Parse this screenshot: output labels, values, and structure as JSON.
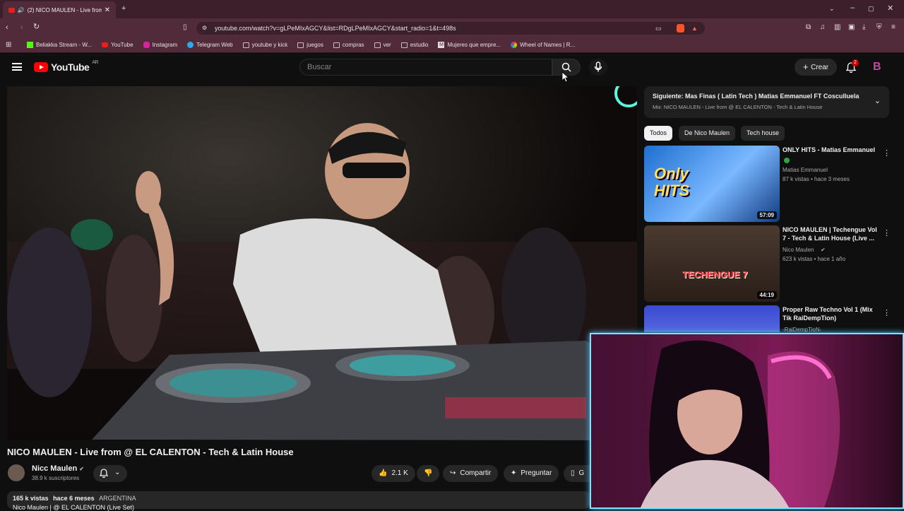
{
  "browser": {
    "tab_title": "(2) NICO MAULEN - Live from",
    "url": "youtube.com/watch?v=gLPeMIxAGCY&list=RDgLPeMIxAGCY&start_radio=1&t=498s",
    "bookmarks": [
      "Beliakka Stream - W...",
      "YouTube",
      "Instagram",
      "Telegram Web",
      "youtube y kick",
      "juegos",
      "compras",
      "ver",
      "estudio",
      "Mujeres que empre...",
      "Wheel of Names | R..."
    ]
  },
  "header": {
    "logo_text": "YouTube",
    "country": "AR",
    "search_placeholder": "Buscar",
    "create_label": "Crear",
    "notif_count": "2"
  },
  "video": {
    "title": "NICO MAULEN - Live from @ EL CALENTON - Tech & Latin House",
    "channel": "Nicc Maulen",
    "subscribers": "38.9 k suscriptores",
    "likes": "2.1 K",
    "share_label": "Compartir",
    "ask_label": "Preguntar",
    "save_label": "G",
    "views": "165 k vistas",
    "date": "hace 6 meses",
    "location": "ARGENTINA",
    "desc_line": "Nico Maulen | @ EL CALENTON (Live Set)"
  },
  "panel": {
    "next_label": "Siguiente:",
    "next_title": "Mas Finas ( Latin Tech ) Matias Emmanuel FT Cosculluela",
    "mix_label": "Mix: NICO MAULEN - Live from @ EL CALENTON - Tech & Latin House",
    "chips": [
      "Todos",
      "De Nico Maulen",
      "Tech house"
    ],
    "recs": [
      {
        "title": "ONLY HITS - Matias Emmanuel",
        "channel": "Matias Emmanuel",
        "meta": "87 k vistas • hace 3 meses",
        "duration": "57:09",
        "thumb_text": "Only HITS"
      },
      {
        "title": "NICO MAULEN | Techengue Vol 7 - Tech & Latin House (Live ...",
        "channel": "Nico Maulen",
        "meta": "623 k vistas • hace 1 año",
        "duration": "44:19",
        "thumb_text": "TECHENGUE 7"
      },
      {
        "title": "Proper Raw Techno Vol 1 (Mix Tik RaiDempTion)",
        "channel": "-RaiDempTioN-",
        "meta": "",
        "duration": "",
        "thumb_text": ""
      }
    ]
  }
}
